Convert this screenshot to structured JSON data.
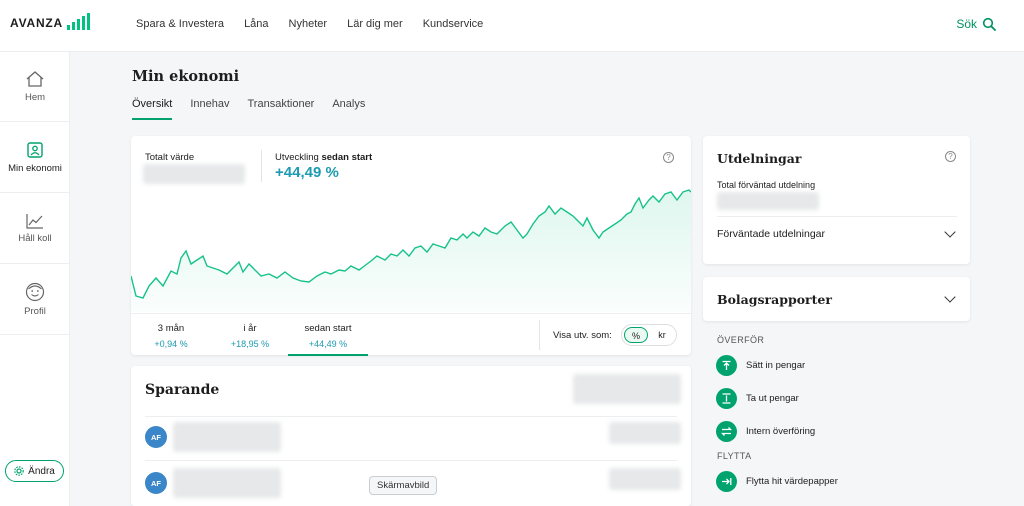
{
  "brand": {
    "name": "AVANZA",
    "accent": "#00a36d",
    "chart_line": "#16c28a",
    "pct_color": "#1d9bb2"
  },
  "nav": [
    "Spara & Investera",
    "Låna",
    "Nyheter",
    "Lär dig mer",
    "Kundservice"
  ],
  "search": {
    "label": "Sök",
    "icon": "search-icon"
  },
  "sidebar": {
    "items": [
      {
        "label": "Hem",
        "icon": "home-icon"
      },
      {
        "label": "Min ekonomi",
        "icon": "person-card-icon"
      },
      {
        "label": "Håll koll",
        "icon": "line-chart-icon"
      },
      {
        "label": "Profil",
        "icon": "profile-face-icon"
      }
    ],
    "edit_button": "Ändra"
  },
  "page": {
    "title": "Min ekonomi"
  },
  "tabs": [
    "Översikt",
    "Innehav",
    "Transaktioner",
    "Analys"
  ],
  "value_card": {
    "total_label": "Totalt värde",
    "dev_label_prefix": "Utveckling ",
    "dev_label_strong": "sedan start",
    "dev_value": "+44,49 %",
    "periods": [
      {
        "label": "3 mån",
        "value": "+0,94 %"
      },
      {
        "label": "i år",
        "value": "+18,95 %"
      },
      {
        "label": "sedan start",
        "value": "+44,49 %"
      }
    ],
    "visa_label": "Visa utv. som:",
    "toggle": [
      "%",
      "kr"
    ]
  },
  "sparande": {
    "title": "Sparande",
    "rows": [
      {
        "avatar": "AF"
      },
      {
        "avatar": "AF"
      }
    ],
    "tooltip": "Skärmavbild"
  },
  "utdelningar": {
    "title": "Utdelningar",
    "expected_label": "Total förväntad utdelning",
    "link": "Förväntade utdelningar"
  },
  "bolag": {
    "title": "Bolagsrapporter"
  },
  "actions": {
    "overfor_label": "ÖVERFÖR",
    "overfor": [
      {
        "label": "Sätt in pengar",
        "icon": "deposit-icon"
      },
      {
        "label": "Ta ut pengar",
        "icon": "withdraw-icon"
      },
      {
        "label": "Intern överföring",
        "icon": "transfer-icon"
      }
    ],
    "flytta_label": "FLYTTA",
    "flytta": [
      {
        "label": "Flytta hit värdepapper",
        "icon": "move-in-icon"
      }
    ]
  }
}
